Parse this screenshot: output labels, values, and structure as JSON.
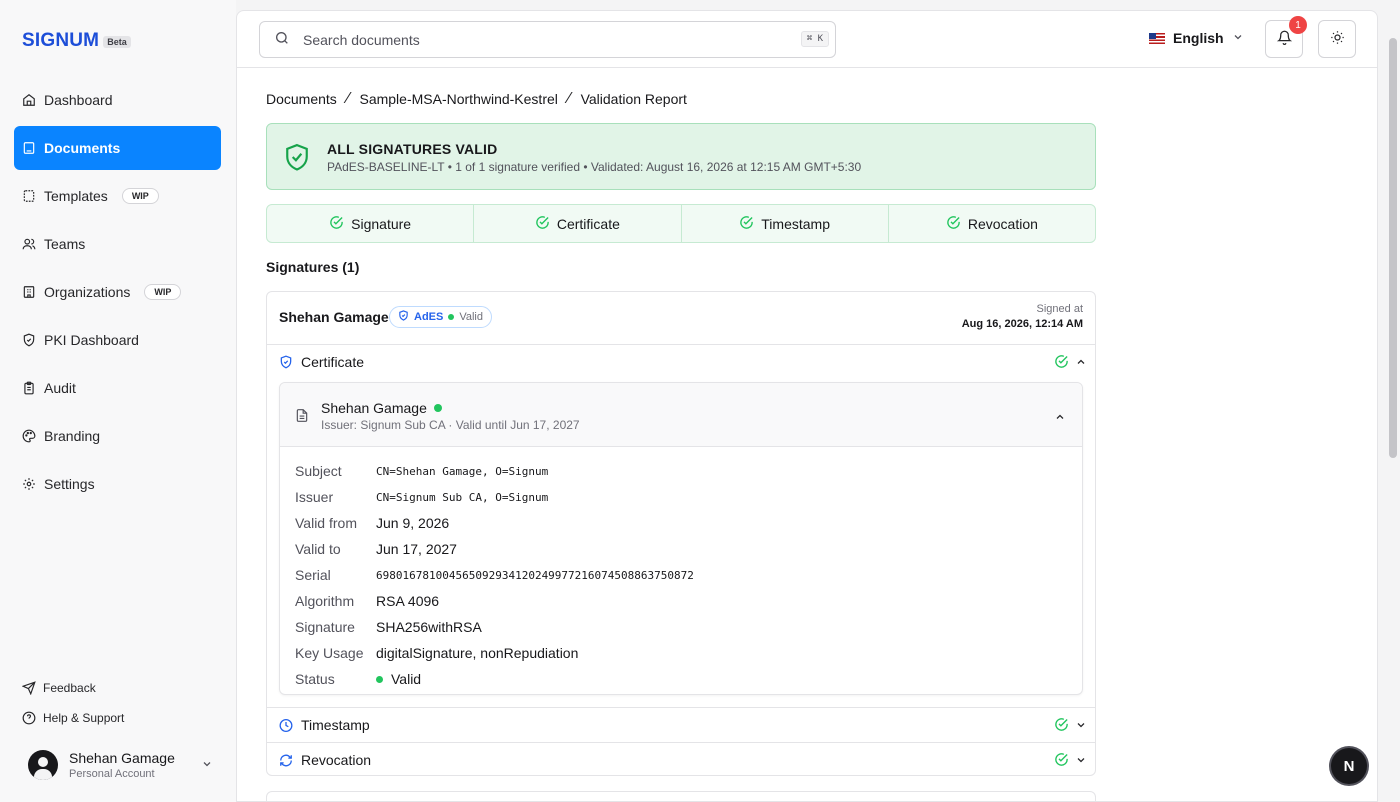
{
  "app": {
    "name": "SIGNUM",
    "badge": "Beta"
  },
  "sidebar": {
    "items": [
      {
        "label": "Dashboard",
        "icon": "home-icon"
      },
      {
        "label": "Documents",
        "icon": "document-icon",
        "active": true
      },
      {
        "label": "Templates",
        "icon": "template-icon",
        "tag": "WIP"
      },
      {
        "label": "Teams",
        "icon": "users-icon"
      },
      {
        "label": "Organizations",
        "icon": "building-icon",
        "tag": "WIP"
      },
      {
        "label": "PKI Dashboard",
        "icon": "shield-icon"
      },
      {
        "label": "Audit",
        "icon": "clipboard-icon"
      },
      {
        "label": "Branding",
        "icon": "palette-icon"
      },
      {
        "label": "Settings",
        "icon": "gear-icon"
      }
    ],
    "footer": {
      "feedback": "Feedback",
      "help": "Help & Support"
    },
    "user": {
      "name": "Shehan Gamage",
      "account": "Personal Account"
    }
  },
  "topbar": {
    "search_placeholder": "Search documents",
    "shortcut": "⌘ K",
    "language": "English",
    "notification_count": "1"
  },
  "breadcrumb": {
    "root": "Documents",
    "document": "Sample-MSA-Northwind-Kestrel",
    "current": "Validation Report"
  },
  "banner": {
    "title": "ALL SIGNATURES VALID",
    "subtitle": "PAdES-BASELINE-LT • 1 of 1 signature verified • Validated: August 16, 2026 at 12:15 AM GMT+5:30"
  },
  "checks": [
    "Signature",
    "Certificate",
    "Timestamp",
    "Revocation"
  ],
  "signatures_heading": "Signatures (1)",
  "signature": {
    "signer": "Shehan Gamage",
    "level": "AdES",
    "status": "Valid",
    "signed_at_label": "Signed at",
    "signed_at": "Aug 16, 2026, 12:14 AM",
    "sections": {
      "certificate": "Certificate",
      "timestamp": "Timestamp",
      "revocation": "Revocation"
    },
    "certificate": {
      "holder": "Shehan Gamage",
      "summary": "Issuer: Signum Sub CA · Valid until Jun 17, 2027",
      "fields": {
        "subject_label": "Subject",
        "subject": "CN=Shehan Gamage, O=Signum",
        "issuer_label": "Issuer",
        "issuer": "CN=Signum Sub CA, O=Signum",
        "valid_from_label": "Valid from",
        "valid_from": "Jun 9, 2026",
        "valid_to_label": "Valid to",
        "valid_to": "Jun 17, 2027",
        "serial_label": "Serial",
        "serial": "698016781004565092934120249977216074508863750872",
        "algorithm_label": "Algorithm",
        "algorithm": "RSA 4096",
        "signature_label": "Signature",
        "signature": "SHA256withRSA",
        "key_usage_label": "Key Usage",
        "key_usage": "digitalSignature, nonRepudiation",
        "status_label": "Status",
        "status": "Valid"
      }
    }
  },
  "colors": {
    "accent": "#0a84ff",
    "success": "#22c55e",
    "brand": "#1d4ed8"
  },
  "floating_button": "N"
}
